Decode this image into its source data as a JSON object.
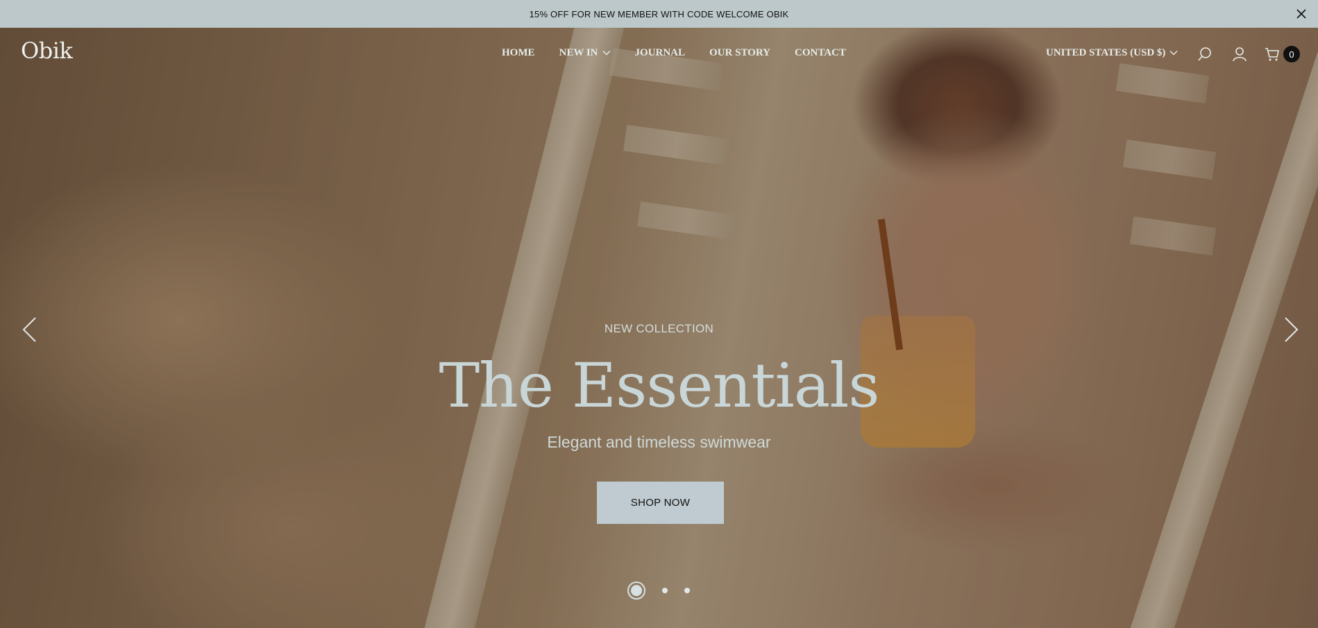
{
  "announcement": {
    "text": "15% OFF FOR NEW MEMBER WITH CODE WELCOME OBIK",
    "close_icon": "close-icon",
    "background": "#bcc8c9"
  },
  "header": {
    "logo": "Obik",
    "nav": [
      {
        "label": "HOME"
      },
      {
        "label": "NEW IN",
        "has_dropdown": true
      },
      {
        "label": "JOURNAL"
      },
      {
        "label": "OUR STORY"
      },
      {
        "label": "CONTACT"
      }
    ],
    "currency": "UNITED STATES (USD $)",
    "icons": [
      "search-icon",
      "account-icon",
      "cart-icon"
    ],
    "cart_count": "0"
  },
  "hero": {
    "eyebrow": "NEW COLLECTION",
    "headline": "The Essentials",
    "subtitle": "Elegant and timeless swimwear",
    "cta_label": "SHOP NOW",
    "cta_color": "#bfcbd0",
    "slides_total": 3,
    "active_slide": 1
  }
}
